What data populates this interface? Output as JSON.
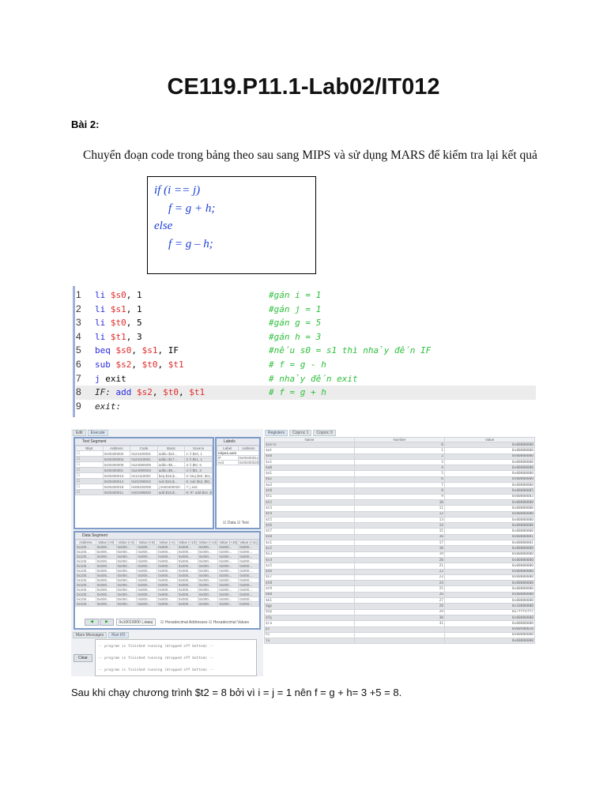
{
  "title": "CE119.P11.1-Lab02/IT012",
  "section": "Bài 2:",
  "instruction": "Chuyển đoạn code trong bảng theo sau sang MIPS và sử dụng MARS để kiểm tra lại kết quả",
  "pseudo": [
    "if (i == j)",
    "f = g + h;",
    "else",
    "f = g – h;"
  ],
  "code": [
    {
      "n": "1",
      "label": "",
      "op": "li",
      "args": [
        [
          "$s0",
          "r"
        ],
        [
          ", 1",
          "p"
        ]
      ],
      "comment": "#gán i = 1"
    },
    {
      "n": "2",
      "label": "",
      "op": "li",
      "args": [
        [
          "$s1",
          "r"
        ],
        [
          ", 1",
          "p"
        ]
      ],
      "comment": "#gán j = 1"
    },
    {
      "n": "3",
      "label": "",
      "op": "li",
      "args": [
        [
          "$t0",
          "r"
        ],
        [
          ", 5",
          "p"
        ]
      ],
      "comment": "#gán g = 5"
    },
    {
      "n": "4",
      "label": "",
      "op": "li",
      "args": [
        [
          "$t1",
          "r"
        ],
        [
          ", 3",
          "p"
        ]
      ],
      "comment": "#gán h = 3"
    },
    {
      "n": "5",
      "label": "",
      "op": "beq",
      "args": [
        [
          "$s0",
          "r"
        ],
        [
          ", ",
          "p"
        ],
        [
          "$s1",
          "r"
        ],
        [
          ", IF",
          "p"
        ]
      ],
      "comment": "#nếu s0 = s1 thì nhảy đến IF"
    },
    {
      "n": "6",
      "label": "",
      "op": "sub",
      "args": [
        [
          "$s2",
          "r"
        ],
        [
          ", ",
          "p"
        ],
        [
          "$t0",
          "r"
        ],
        [
          ", ",
          "p"
        ],
        [
          "$t1",
          "r"
        ]
      ],
      "comment": "# f = g - h"
    },
    {
      "n": "7",
      "label": "",
      "op": "j",
      "args": [
        [
          "exit",
          "p"
        ]
      ],
      "comment": "# nhảy đến exit"
    },
    {
      "n": "8",
      "label": "IF:",
      "op": "add",
      "args": [
        [
          "$s2",
          "r"
        ],
        [
          ", ",
          "p"
        ],
        [
          "$t0",
          "r"
        ],
        [
          ", ",
          "p"
        ],
        [
          "$t1",
          "r"
        ]
      ],
      "comment": "# f = g + h"
    },
    {
      "n": "9",
      "label": "exit:",
      "op": "",
      "args": [],
      "comment": ""
    }
  ],
  "mars": {
    "main_tabs": [
      "Edit",
      "Execute"
    ],
    "text_segment": {
      "title": "Text Segment",
      "headers": [
        "Bkpt",
        "Address",
        "Code",
        "Basic",
        "Source"
      ],
      "rows": [
        [
          "0x00400000",
          "0x24100001",
          "addiu $16...",
          "1: li $s0, 1"
        ],
        [
          "0x00400004",
          "0x24110001",
          "addiu $17...",
          "2: li $s1, 1"
        ],
        [
          "0x00400008",
          "0x24080005",
          "addiu $8,...",
          "3: li $t0, 5"
        ],
        [
          "0x0040000c",
          "0x24090003",
          "addiu $9,...",
          "4: li $t1, 3"
        ],
        [
          "0x00400010",
          "0x12110002",
          "beq $16,$...",
          "5: beq $s0, $s1,"
        ],
        [
          "0x00400014",
          "0x01099022",
          "sub $18,$...",
          "6: sub $s2, $t0,"
        ],
        [
          "0x00400018",
          "0x08100008",
          "j 0x00400020",
          "7: j exit"
        ],
        [
          "0x0040001c",
          "0x01099020",
          "add $18,$...",
          "8: IF: add $s2, $..."
        ]
      ]
    },
    "labels": {
      "title": "Labels",
      "headers": [
        "Label",
        "Address"
      ],
      "file": "mips1.asm",
      "rows": [
        [
          "IF",
          "0x0040001c"
        ],
        [
          "exit",
          "0x00400020"
        ]
      ],
      "data_check": "Data",
      "text_check": "Text"
    },
    "data_segment": {
      "title": "Data Segment",
      "headers": [
        "Address",
        "Value (+0)",
        "Value (+4)",
        "Value (+8)",
        "Value (+c)",
        "Value (+10)",
        "Value (+14)",
        "Value (+18)",
        "Value (+1c)"
      ],
      "row_addr": "0x100...",
      "row_val": "0x000...",
      "row_count": 13,
      "address_select": "0x10010000 (.data)",
      "hex_addresses": "Hexadecimal Addresses",
      "hex_values": "Hexadecimal Values"
    },
    "msg_tabs": [
      "Mars Messages",
      "Run I/O"
    ],
    "clear": "Clear",
    "messages": [
      "-- program is finished running (dropped off bottom) --",
      "-- program is finished running (dropped off bottom) --",
      "-- program is finished running (dropped off bottom) --"
    ],
    "reg_tabs": [
      "Registers",
      "Coproc 1",
      "Coproc 0"
    ],
    "reg_headers": [
      "Name",
      "Number",
      "Value"
    ],
    "registers": [
      [
        "$zero",
        "0",
        "0x00000000"
      ],
      [
        "$at",
        "1",
        "0x00000000"
      ],
      [
        "$v0",
        "2",
        "0x00000000"
      ],
      [
        "$v1",
        "3",
        "0x00000000"
      ],
      [
        "$a0",
        "4",
        "0x00000000"
      ],
      [
        "$a1",
        "5",
        "0x00000000"
      ],
      [
        "$a2",
        "6",
        "0x00000000"
      ],
      [
        "$a3",
        "7",
        "0x00000000"
      ],
      [
        "$t0",
        "8",
        "0x00000005"
      ],
      [
        "$t1",
        "9",
        "0x00000003"
      ],
      [
        "$t2",
        "10",
        "0x00000000"
      ],
      [
        "$t3",
        "11",
        "0x00000000"
      ],
      [
        "$t4",
        "12",
        "0x00000000"
      ],
      [
        "$t5",
        "13",
        "0x00000000"
      ],
      [
        "$t6",
        "14",
        "0x00000000"
      ],
      [
        "$t7",
        "15",
        "0x00000000"
      ],
      [
        "$s0",
        "16",
        "0x00000001"
      ],
      [
        "$s1",
        "17",
        "0x00000001"
      ],
      [
        "$s2",
        "18",
        "0x00000008"
      ],
      [
        "$s3",
        "19",
        "0x00000000"
      ],
      [
        "$s4",
        "20",
        "0x00000000"
      ],
      [
        "$s5",
        "21",
        "0x00000000"
      ],
      [
        "$s6",
        "22",
        "0x00000000"
      ],
      [
        "$s7",
        "23",
        "0x00000000"
      ],
      [
        "$t8",
        "24",
        "0x00000000"
      ],
      [
        "$t9",
        "25",
        "0x00000000"
      ],
      [
        "$k0",
        "26",
        "0x00000000"
      ],
      [
        "$k1",
        "27",
        "0x00000000"
      ],
      [
        "$gp",
        "28",
        "0x10008000"
      ],
      [
        "$sp",
        "29",
        "0x7fffeffc"
      ],
      [
        "$fp",
        "30",
        "0x00000000"
      ],
      [
        "$ra",
        "31",
        "0x00000000"
      ],
      [
        "pc",
        "",
        "0x00400020"
      ],
      [
        "hi",
        "",
        "0x00000000"
      ],
      [
        "lo",
        "",
        "0x00000000"
      ]
    ]
  },
  "result": "Sau khi chạy chương trình $t2 = 8 bởi vì i = j = 1 nên f = g + h= 3 +5 = 8."
}
